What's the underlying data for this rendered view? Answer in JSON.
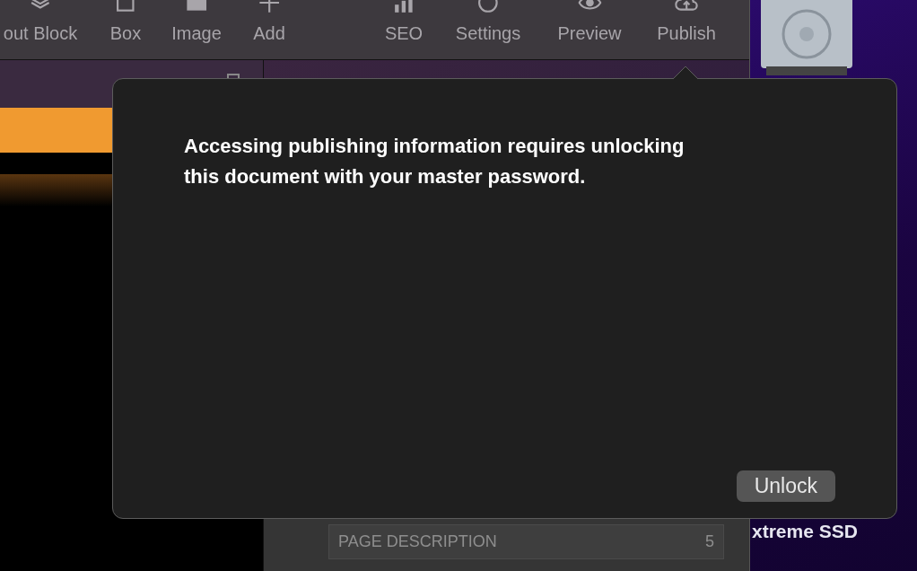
{
  "toolbar": {
    "items": [
      {
        "label": "out Block"
      },
      {
        "label": "Box"
      },
      {
        "label": "Image"
      },
      {
        "label": "Add"
      },
      {
        "label": "SEO"
      },
      {
        "label": "Settings"
      },
      {
        "label": "Preview"
      },
      {
        "label": "Publish"
      }
    ]
  },
  "popover": {
    "message": "Accessing publishing information requires unlocking this document with your master password.",
    "button": "Unlock"
  },
  "inspector": {
    "field_label": "PAGE DESCRIPTION",
    "field_value": "5"
  },
  "desktop": {
    "drive_label": "xtreme SSD"
  }
}
